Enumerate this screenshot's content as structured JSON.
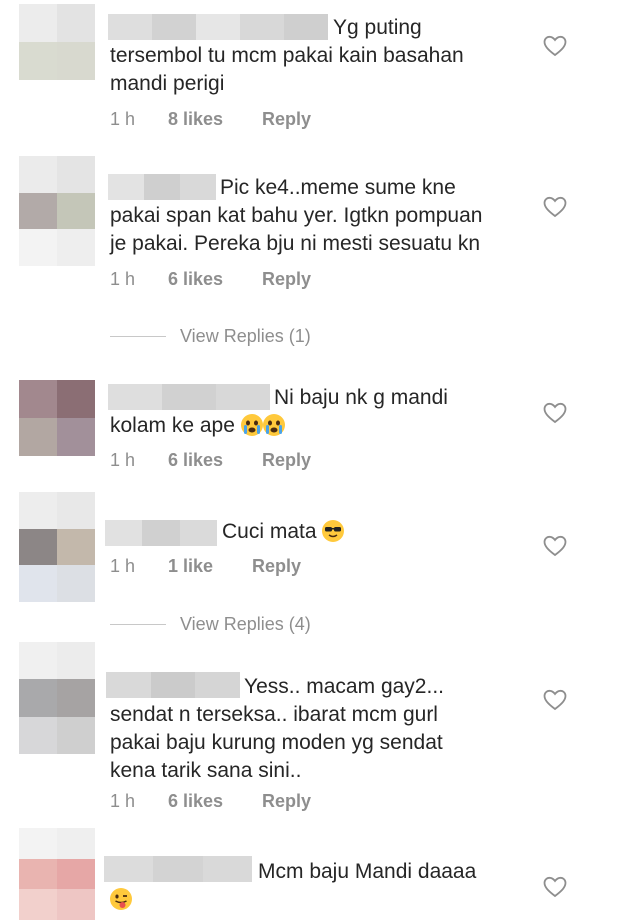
{
  "comments": [
    {
      "text_a": "Yg puting",
      "text_b": "tersembol tu mcm pakai kain basahan\nmandi perigi",
      "time": "1 h",
      "likes": "8 likes",
      "reply": "Reply"
    },
    {
      "text_a": "Pic ke4..meme sume kne",
      "text_b": "pakai span kat bahu yer. Igtkn pompuan\nje pakai. Pereka bju ni mesti sesuatu kn",
      "time": "1 h",
      "likes": "6 likes",
      "reply": "Reply"
    },
    {
      "text_a": "Ni baju nk g mandi",
      "text_b": "kolam ke ape",
      "time": "1 h",
      "likes": "6 likes",
      "reply": "Reply",
      "emoji": "crying-emoji"
    },
    {
      "text_a": "Cuci mata",
      "text_b": "",
      "time": "1 h",
      "likes": "1 like",
      "reply": "Reply",
      "emoji": "sunglasses-emoji"
    },
    {
      "text_a": "Yess.. macam gay2...",
      "text_b": "sendat n terseksa.. ibarat mcm gurl\npakai baju kurung moden yg sendat\nkena tarik sana sini..",
      "time": "1 h",
      "likes": "6 likes",
      "reply": "Reply"
    },
    {
      "text_a": "Mcm baju Mandi daaaa",
      "text_b": "",
      "time": "",
      "likes": "",
      "reply": "",
      "emoji": "tongue-emoji"
    }
  ],
  "view_replies": [
    "View Replies (1)",
    "View Replies (4)"
  ],
  "icons": {
    "heart": "heart-outline-icon"
  }
}
